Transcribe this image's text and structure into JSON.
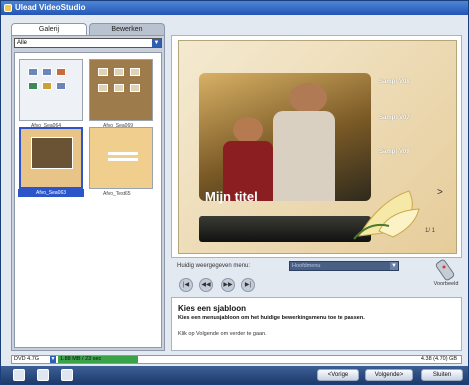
{
  "window": {
    "title": "Ulead VideoStudio"
  },
  "left_panel": {
    "tabs": [
      "Galerij",
      "Bewerken"
    ],
    "dropdown": {
      "value": "Alle"
    },
    "templates": [
      {
        "caption": "Afvo_Sea064"
      },
      {
        "caption": "Afvo_Sea069"
      },
      {
        "caption": "Afvo_Sea063"
      },
      {
        "caption": "Afvo_Test65"
      }
    ]
  },
  "preview": {
    "title_text": "Mijn titel",
    "samples": [
      "Sampl-V08",
      "Sampl-V07",
      "Sampl-V09"
    ],
    "next_arrow": ">",
    "page_indicator": "1/ 1"
  },
  "menu_row": {
    "label": "Huidig weergegeven menu:",
    "selected": "Hoofdmenu",
    "preview_button": "Voorbeeld"
  },
  "description": {
    "heading": "Kies een sjabloon",
    "body": "Kies een menusjabloon om het huidige bewerkingsmenu toe te passen.",
    "hint": "Klik op Volgende om verder te gaan."
  },
  "status": {
    "disc": "DVD 4.7G",
    "capacity": "1.88 MB / 23 sec",
    "total": "4.38 (4.70) GB"
  },
  "buttons": {
    "back": "<Vorige",
    "next": "Volgende>",
    "close": "Sluiten"
  },
  "colors": {
    "accent": "#2b55c9",
    "titlebar": "#2455b6",
    "bottombar": "#1d3a6b"
  }
}
